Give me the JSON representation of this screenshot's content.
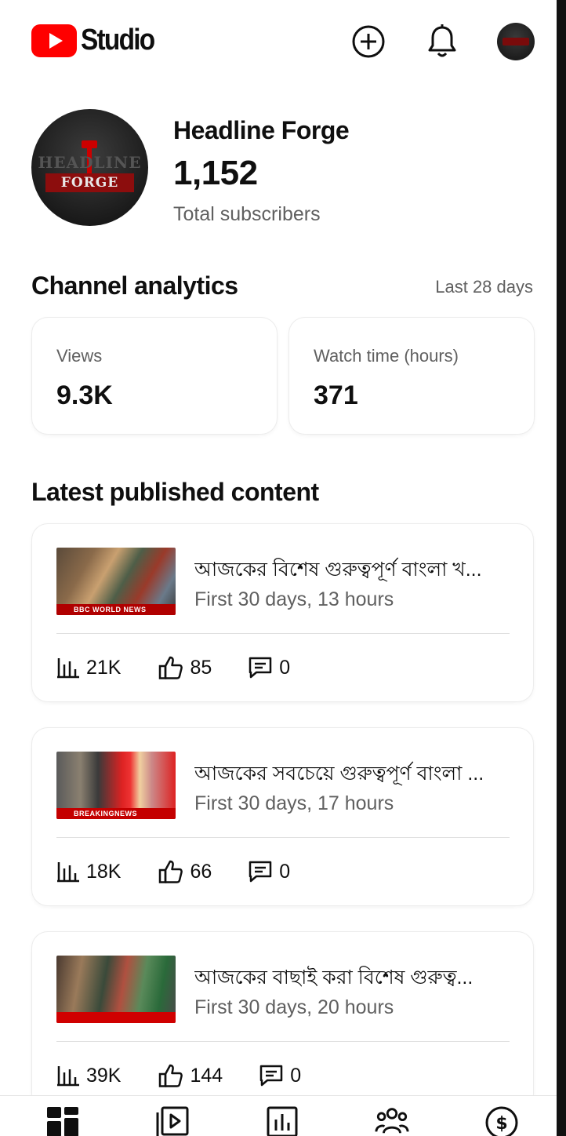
{
  "header": {
    "logo_text": "Studio",
    "icons": [
      "create-icon",
      "notifications-icon",
      "account-avatar"
    ]
  },
  "channel": {
    "name": "Headline Forge",
    "subscribers": "1,152",
    "subscribers_label": "Total subscribers",
    "avatar_text_top": "HEADLINE",
    "avatar_text_bottom": "FORGE"
  },
  "analytics": {
    "title": "Channel analytics",
    "period": "Last 28 days",
    "cards": [
      {
        "label": "Views",
        "value": "9.3K"
      },
      {
        "label": "Watch time (hours)",
        "value": "371"
      }
    ]
  },
  "latest": {
    "title": "Latest published content",
    "items": [
      {
        "title": "আজকের বিশেষ গুরুত্বপূর্ণ বাংলা খ...",
        "meta": "First 30 days, 13 hours",
        "views": "21K",
        "likes": "85",
        "comments": "0",
        "thumb_band_text": "BBC WORLD NEWS",
        "thumb_band_color": "#b00000"
      },
      {
        "title": "আজকের সবচেয়ে গুরুত্বপূর্ণ বাংলা ...",
        "meta": "First 30 days, 17 hours",
        "views": "18K",
        "likes": "66",
        "comments": "0",
        "thumb_band_text": "BREAKINGNEWS",
        "thumb_band_color": "#c40000"
      },
      {
        "title": "আজকের বাছাই করা বিশেষ গুরুত্ব...",
        "meta": "First 30 days, 20 hours",
        "views": "39K",
        "likes": "144",
        "comments": "0",
        "thumb_band_text": "",
        "thumb_band_color": "#d00000"
      }
    ]
  },
  "bottom_nav": [
    "dashboard-icon",
    "content-icon",
    "analytics-icon",
    "community-icon",
    "earn-icon"
  ],
  "colors": {
    "brand_red": "#ff0000",
    "text_primary": "#0f0f0f",
    "text_secondary": "#606060"
  }
}
